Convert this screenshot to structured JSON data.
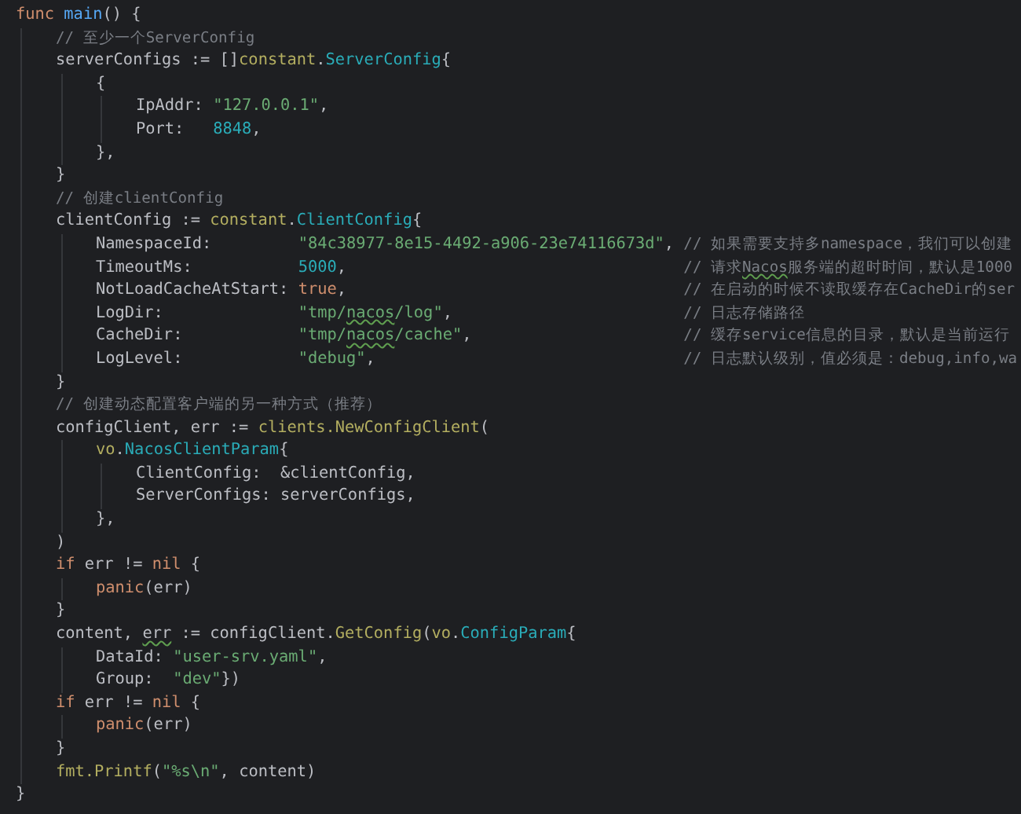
{
  "editor": {
    "lines": [
      {
        "tokens": [
          {
            "kind": "kw",
            "text": "func "
          },
          {
            "kind": "fn",
            "text": "main"
          },
          {
            "kind": "plain",
            "text": "() {"
          }
        ],
        "children": [
          {
            "tokens": [
              {
                "kind": "cmt",
                "text": "// 至少一个ServerConfig"
              }
            ]
          },
          {
            "tokens": [
              {
                "kind": "plain",
                "text": "serverConfigs := []"
              },
              {
                "kind": "pkg",
                "text": "constant"
              },
              {
                "kind": "plain",
                "text": "."
              },
              {
                "kind": "type",
                "text": "ServerConfig"
              },
              {
                "kind": "plain",
                "text": "{"
              }
            ],
            "children": [
              {
                "tokens": [
                  {
                    "kind": "plain",
                    "text": "{"
                  }
                ],
                "children": [
                  {
                    "tokens": [
                      {
                        "kind": "plain",
                        "text": "IpAddr: "
                      },
                      {
                        "kind": "str",
                        "text": "\"127.0.0.1\""
                      },
                      {
                        "kind": "plain",
                        "text": ","
                      }
                    ]
                  },
                  {
                    "tokens": [
                      {
                        "kind": "plain",
                        "text": "Port:   "
                      },
                      {
                        "kind": "num",
                        "text": "8848"
                      },
                      {
                        "kind": "plain",
                        "text": ","
                      }
                    ]
                  }
                ]
              },
              {
                "tokens": [
                  {
                    "kind": "plain",
                    "text": "},"
                  }
                ]
              }
            ]
          },
          {
            "tokens": [
              {
                "kind": "plain",
                "text": "}"
              }
            ]
          },
          {
            "tokens": [
              {
                "kind": "cmt",
                "text": "// 创建clientConfig"
              }
            ]
          },
          {
            "tokens": [
              {
                "kind": "plain",
                "text": "clientConfig := "
              },
              {
                "kind": "pkg",
                "text": "constant"
              },
              {
                "kind": "plain",
                "text": "."
              },
              {
                "kind": "type",
                "text": "ClientConfig"
              },
              {
                "kind": "plain",
                "text": "{"
              }
            ],
            "children": [
              {
                "tokens": [
                  {
                    "kind": "plain",
                    "text": "NamespaceId:         "
                  },
                  {
                    "kind": "str",
                    "text": "\"84c38977-8e15-4492-a906-23e74116673d\""
                  },
                  {
                    "kind": "plain",
                    "text": ", "
                  },
                  {
                    "kind": "cmt",
                    "text": "// 如果需要支持多namespace，我们可以创建"
                  }
                ]
              },
              {
                "tokens": [
                  {
                    "kind": "plain",
                    "text": "TimeoutMs:           "
                  },
                  {
                    "kind": "num",
                    "text": "5000"
                  },
                  {
                    "kind": "plain",
                    "text": ",                                   "
                  },
                  {
                    "kind": "cmt",
                    "text": "// 请求"
                  },
                  {
                    "kind": "cmt",
                    "text": "Nacos",
                    "squiggle": true
                  },
                  {
                    "kind": "cmt",
                    "text": "服务端的超时时间，默认是1000"
                  }
                ]
              },
              {
                "tokens": [
                  {
                    "kind": "plain",
                    "text": "NotLoadCacheAtStart: "
                  },
                  {
                    "kind": "kw",
                    "text": "true"
                  },
                  {
                    "kind": "plain",
                    "text": ",                                   "
                  },
                  {
                    "kind": "cmt",
                    "text": "// 在启动的时候不读取缓存在CacheDir的ser"
                  }
                ]
              },
              {
                "tokens": [
                  {
                    "kind": "plain",
                    "text": "LogDir:              "
                  },
                  {
                    "kind": "str",
                    "text": "\"tmp/"
                  },
                  {
                    "kind": "str",
                    "text": "nacos",
                    "squiggle": true
                  },
                  {
                    "kind": "str",
                    "text": "/log\""
                  },
                  {
                    "kind": "plain",
                    "text": ",                        "
                  },
                  {
                    "kind": "cmt",
                    "text": "// 日志存储路径"
                  }
                ]
              },
              {
                "tokens": [
                  {
                    "kind": "plain",
                    "text": "CacheDir:            "
                  },
                  {
                    "kind": "str",
                    "text": "\"tmp/"
                  },
                  {
                    "kind": "str",
                    "text": "nacos",
                    "squiggle": true
                  },
                  {
                    "kind": "str",
                    "text": "/cache\""
                  },
                  {
                    "kind": "plain",
                    "text": ",                      "
                  },
                  {
                    "kind": "cmt",
                    "text": "// 缓存service信息的目录，默认是当前运行"
                  }
                ]
              },
              {
                "tokens": [
                  {
                    "kind": "plain",
                    "text": "LogLevel:            "
                  },
                  {
                    "kind": "str",
                    "text": "\"debug\""
                  },
                  {
                    "kind": "plain",
                    "text": ",                                "
                  },
                  {
                    "kind": "cmt",
                    "text": "// 日志默认级别，值必须是：debug,info,wa"
                  }
                ]
              }
            ]
          },
          {
            "tokens": [
              {
                "kind": "plain",
                "text": "}"
              }
            ]
          },
          {
            "tokens": [
              {
                "kind": "cmt",
                "text": "// 创建动态配置客户端的另一种方式（推荐）"
              }
            ]
          },
          {
            "tokens": [
              {
                "kind": "plain",
                "text": "configClient, err := "
              },
              {
                "kind": "pkg",
                "text": "clients.NewConfigClient"
              },
              {
                "kind": "plain",
                "text": "("
              }
            ],
            "children": [
              {
                "tokens": [
                  {
                    "kind": "pkg",
                    "text": "vo"
                  },
                  {
                    "kind": "plain",
                    "text": "."
                  },
                  {
                    "kind": "type",
                    "text": "NacosClientParam"
                  },
                  {
                    "kind": "plain",
                    "text": "{"
                  }
                ],
                "children": [
                  {
                    "tokens": [
                      {
                        "kind": "plain",
                        "text": "ClientConfig:  &clientConfig,"
                      }
                    ]
                  },
                  {
                    "tokens": [
                      {
                        "kind": "plain",
                        "text": "ServerConfigs: serverConfigs,"
                      }
                    ]
                  }
                ]
              },
              {
                "tokens": [
                  {
                    "kind": "plain",
                    "text": "},"
                  }
                ]
              }
            ]
          },
          {
            "tokens": [
              {
                "kind": "plain",
                "text": ")"
              }
            ]
          },
          {
            "tokens": [
              {
                "kind": "kw",
                "text": "if "
              },
              {
                "kind": "plain",
                "text": "err != "
              },
              {
                "kind": "kw",
                "text": "nil"
              },
              {
                "kind": "plain",
                "text": " {"
              }
            ],
            "children": [
              {
                "tokens": [
                  {
                    "kind": "kw",
                    "text": "panic"
                  },
                  {
                    "kind": "plain",
                    "text": "(err)"
                  }
                ]
              }
            ]
          },
          {
            "tokens": [
              {
                "kind": "plain",
                "text": "}"
              }
            ]
          },
          {
            "tokens": [
              {
                "kind": "plain",
                "text": "content, "
              },
              {
                "kind": "plain",
                "text": "err",
                "squiggle": true
              },
              {
                "kind": "plain",
                "text": " := configClient."
              },
              {
                "kind": "pkg",
                "text": "GetConfig"
              },
              {
                "kind": "plain",
                "text": "("
              },
              {
                "kind": "pkg",
                "text": "vo"
              },
              {
                "kind": "plain",
                "text": "."
              },
              {
                "kind": "type",
                "text": "ConfigParam"
              },
              {
                "kind": "plain",
                "text": "{"
              }
            ],
            "children": [
              {
                "tokens": [
                  {
                    "kind": "plain",
                    "text": "DataId: "
                  },
                  {
                    "kind": "str",
                    "text": "\"user-srv.yaml\""
                  },
                  {
                    "kind": "plain",
                    "text": ","
                  }
                ]
              },
              {
                "tokens": [
                  {
                    "kind": "plain",
                    "text": "Group:  "
                  },
                  {
                    "kind": "str",
                    "text": "\"dev\""
                  },
                  {
                    "kind": "plain",
                    "text": "})"
                  }
                ]
              }
            ]
          },
          {
            "tokens": [
              {
                "kind": "kw",
                "text": "if "
              },
              {
                "kind": "plain",
                "text": "err != "
              },
              {
                "kind": "kw",
                "text": "nil"
              },
              {
                "kind": "plain",
                "text": " {"
              }
            ],
            "children": [
              {
                "tokens": [
                  {
                    "kind": "kw",
                    "text": "panic"
                  },
                  {
                    "kind": "plain",
                    "text": "(err)"
                  }
                ]
              }
            ]
          },
          {
            "tokens": [
              {
                "kind": "plain",
                "text": "}"
              }
            ]
          },
          {
            "tokens": [
              {
                "kind": "pkg",
                "text": "fmt.Printf"
              },
              {
                "kind": "plain",
                "text": "("
              },
              {
                "kind": "str",
                "text": "\"%s\\n\""
              },
              {
                "kind": "plain",
                "text": ", content)"
              }
            ]
          }
        ]
      },
      {
        "tokens": [
          {
            "kind": "plain",
            "text": "}"
          }
        ]
      }
    ]
  }
}
